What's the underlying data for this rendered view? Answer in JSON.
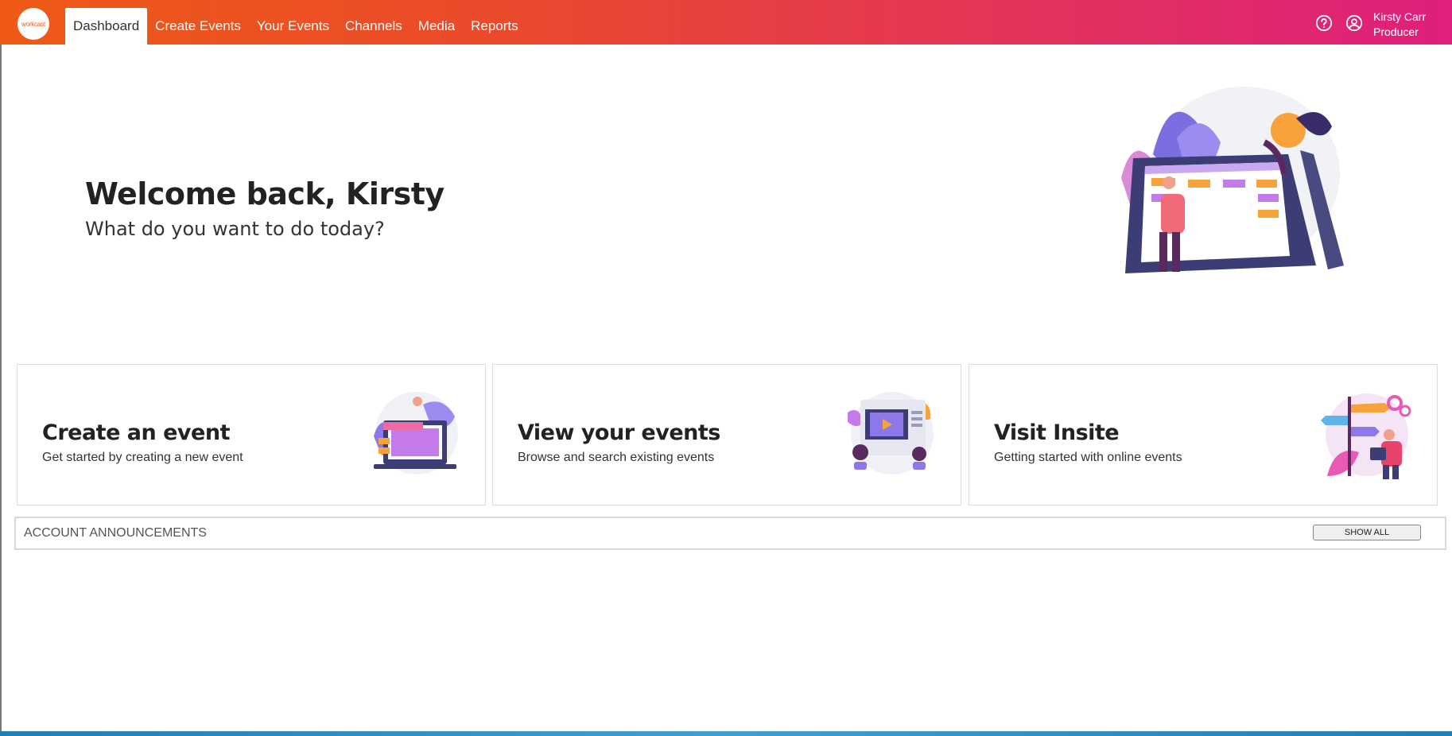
{
  "app": {
    "logo_text": "workcast"
  },
  "nav": {
    "items": [
      {
        "label": "Dashboard",
        "active": true
      },
      {
        "label": "Create Events"
      },
      {
        "label": "Your Events"
      },
      {
        "label": "Channels"
      },
      {
        "label": "Media"
      },
      {
        "label": "Reports"
      }
    ]
  },
  "user": {
    "name": "Kirsty Carr",
    "role": "Producer"
  },
  "icons": {
    "help": "help-circle-icon",
    "user": "user-circle-icon"
  },
  "hero": {
    "title": "Welcome back, Kirsty",
    "subtitle": "What do you want to do today?"
  },
  "cards": [
    {
      "title": "Create an event",
      "description": "Get started by creating a new event"
    },
    {
      "title": "View your events",
      "description": "Browse and search existing events"
    },
    {
      "title": "Visit Insite",
      "description": "Getting started with online events"
    }
  ],
  "announcements": {
    "title": "ACCOUNT ANNOUNCEMENTS",
    "show_all_label": "SHOW ALL"
  },
  "colors": {
    "brand_orange": "#ee5a16",
    "brand_pink": "#df1f7c"
  }
}
